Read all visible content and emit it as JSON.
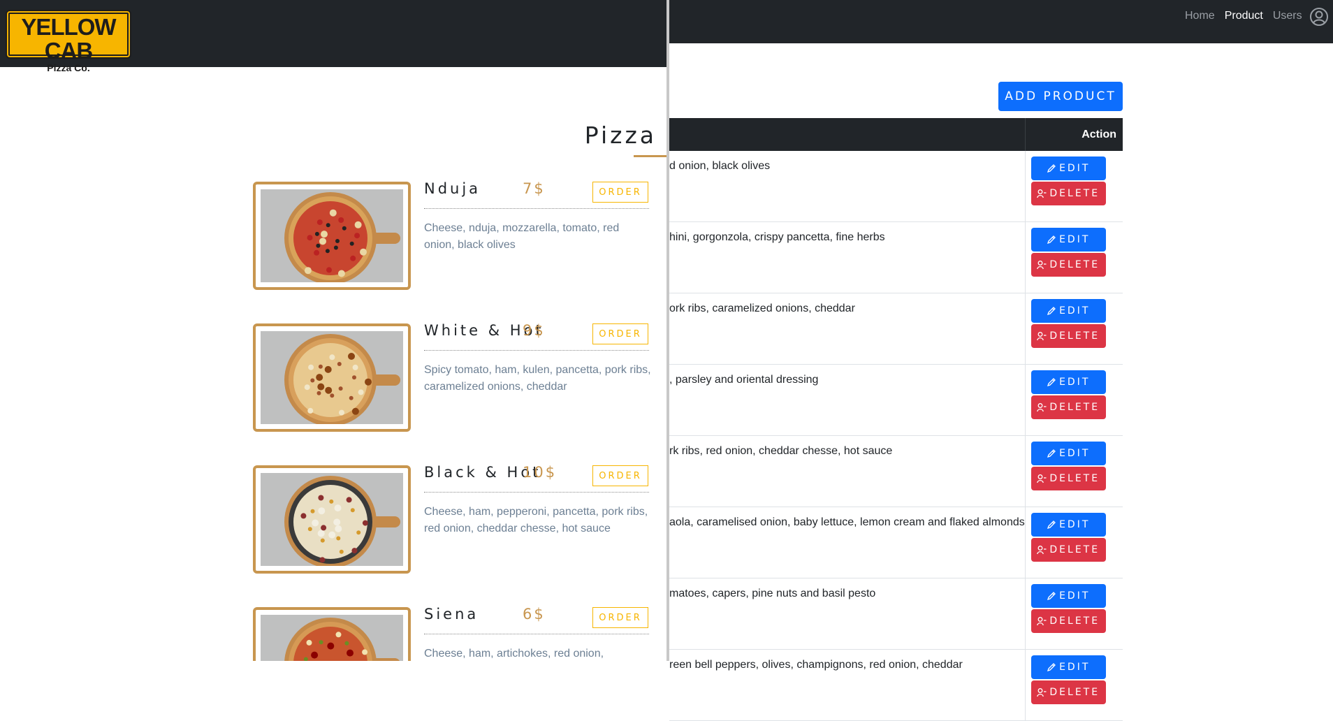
{
  "admin": {
    "nav": [
      "Home",
      "Product",
      "Users"
    ],
    "nav_active": "Product",
    "add_product_label": "ADD PRODUCT",
    "table_header": {
      "action": "Action"
    },
    "rows": [
      {
        "description": "d onion, black olives"
      },
      {
        "description": "hini, gorgonzola, crispy pancetta, fine herbs"
      },
      {
        "description": "ork ribs, caramelized onions, cheddar"
      },
      {
        "description": ", parsley and oriental dressing"
      },
      {
        "description": "rk ribs, red onion, cheddar chesse, hot sauce"
      },
      {
        "description": "aola, caramelised onion, baby lettuce, lemon cream and flaked almonds"
      },
      {
        "description": "matoes, capers, pine nuts and basil pesto"
      },
      {
        "description": "reen bell peppers, olives, champignons, red onion, cheddar"
      }
    ],
    "edit_label": "EDIT",
    "delete_label": "DELETE",
    "colors": {
      "primary": "#0d6efd",
      "danger": "#dc3545",
      "navbar": "#212529"
    }
  },
  "menu": {
    "logo": {
      "main": "YELLOW CAB",
      "sub": "Pizza Co."
    },
    "section_title": "Pizza",
    "order_label": "ORDER",
    "items": [
      {
        "name": "Nduja",
        "price": "7$",
        "description": "Cheese, nduja, mozzarella, tomato, red onion, black olives"
      },
      {
        "name": "White & Hot",
        "price": "9$",
        "description": "Spicy tomato, ham, kulen, pancetta, pork ribs, caramelized onions, cheddar"
      },
      {
        "name": "Black & Hot",
        "price": "10$",
        "description": "Cheese, ham, pepperoni, pancetta, pork ribs, red onion, cheddar chesse, hot sauce"
      },
      {
        "name": "Siena",
        "price": "6$",
        "description": "Cheese, ham, artichokes, red onion, tomatoes,"
      }
    ],
    "colors": {
      "accent": "#c8964f",
      "order": "#f7b500"
    }
  }
}
